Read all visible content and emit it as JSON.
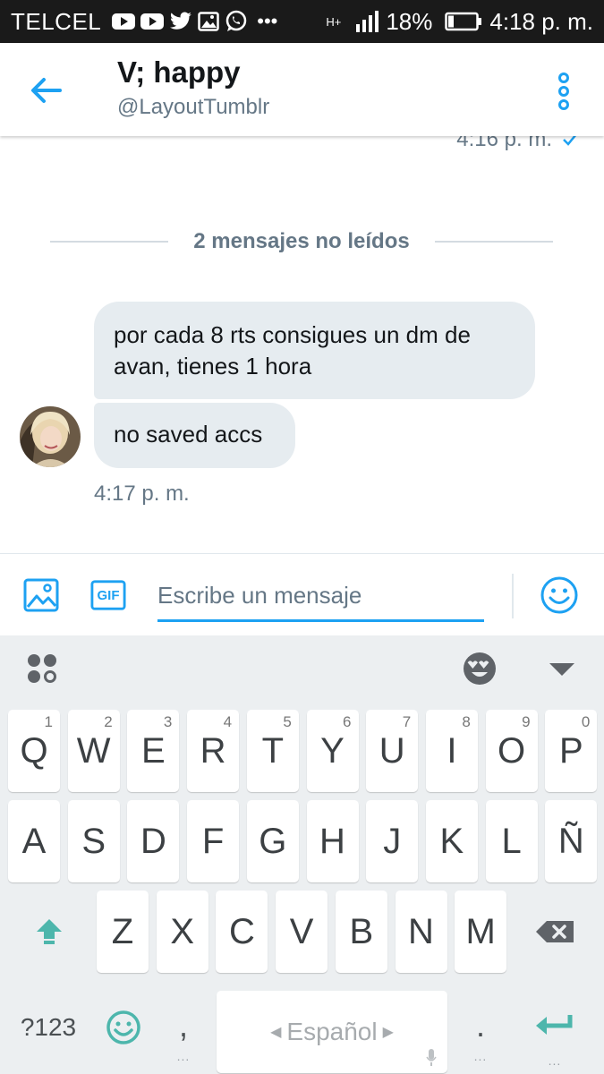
{
  "status_bar": {
    "carrier": "TELCEL",
    "network": "H+",
    "battery": "18%",
    "time": "4:18 p. m.",
    "icons": [
      "youtube-icon",
      "youtube-icon",
      "twitter-icon",
      "gallery-icon",
      "whatsapp-icon",
      "more-dots-icon",
      "signal-icon",
      "battery-icon"
    ]
  },
  "header": {
    "title": "V; happy",
    "handle": "@LayoutTumblr"
  },
  "chat": {
    "previous_time": "4:16 p. m.",
    "unread_divider": "2 mensajes no leídos",
    "messages": [
      {
        "text": "por cada 8 rts consigues un dm de avan, tienes 1 hora"
      },
      {
        "text": "no saved accs"
      }
    ],
    "message_time": "4:17 p. m."
  },
  "compose": {
    "placeholder": "Escribe un mensaje",
    "gif_label": "GIF"
  },
  "keyboard": {
    "rows": [
      [
        {
          "l": "Q",
          "n": "1"
        },
        {
          "l": "W",
          "n": "2"
        },
        {
          "l": "E",
          "n": "3"
        },
        {
          "l": "R",
          "n": "4"
        },
        {
          "l": "T",
          "n": "5"
        },
        {
          "l": "Y",
          "n": "6"
        },
        {
          "l": "U",
          "n": "7"
        },
        {
          "l": "I",
          "n": "8"
        },
        {
          "l": "O",
          "n": "9"
        },
        {
          "l": "P",
          "n": "0"
        }
      ],
      [
        {
          "l": "A"
        },
        {
          "l": "S"
        },
        {
          "l": "D"
        },
        {
          "l": "F"
        },
        {
          "l": "G"
        },
        {
          "l": "H"
        },
        {
          "l": "J"
        },
        {
          "l": "K"
        },
        {
          "l": "L"
        },
        {
          "l": "Ñ"
        }
      ],
      [
        {
          "l": "Z"
        },
        {
          "l": "X"
        },
        {
          "l": "C"
        },
        {
          "l": "V"
        },
        {
          "l": "B"
        },
        {
          "l": "N"
        },
        {
          "l": "M"
        }
      ]
    ],
    "symbols_label": "?123",
    "comma_label": ",",
    "period_label": ".",
    "space_label": "Español",
    "accent_color": "#4db6ac"
  },
  "colors": {
    "twitter_blue": "#1da1f2",
    "bubble_bg": "#e6ecf0",
    "secondary_text": "#657786"
  }
}
